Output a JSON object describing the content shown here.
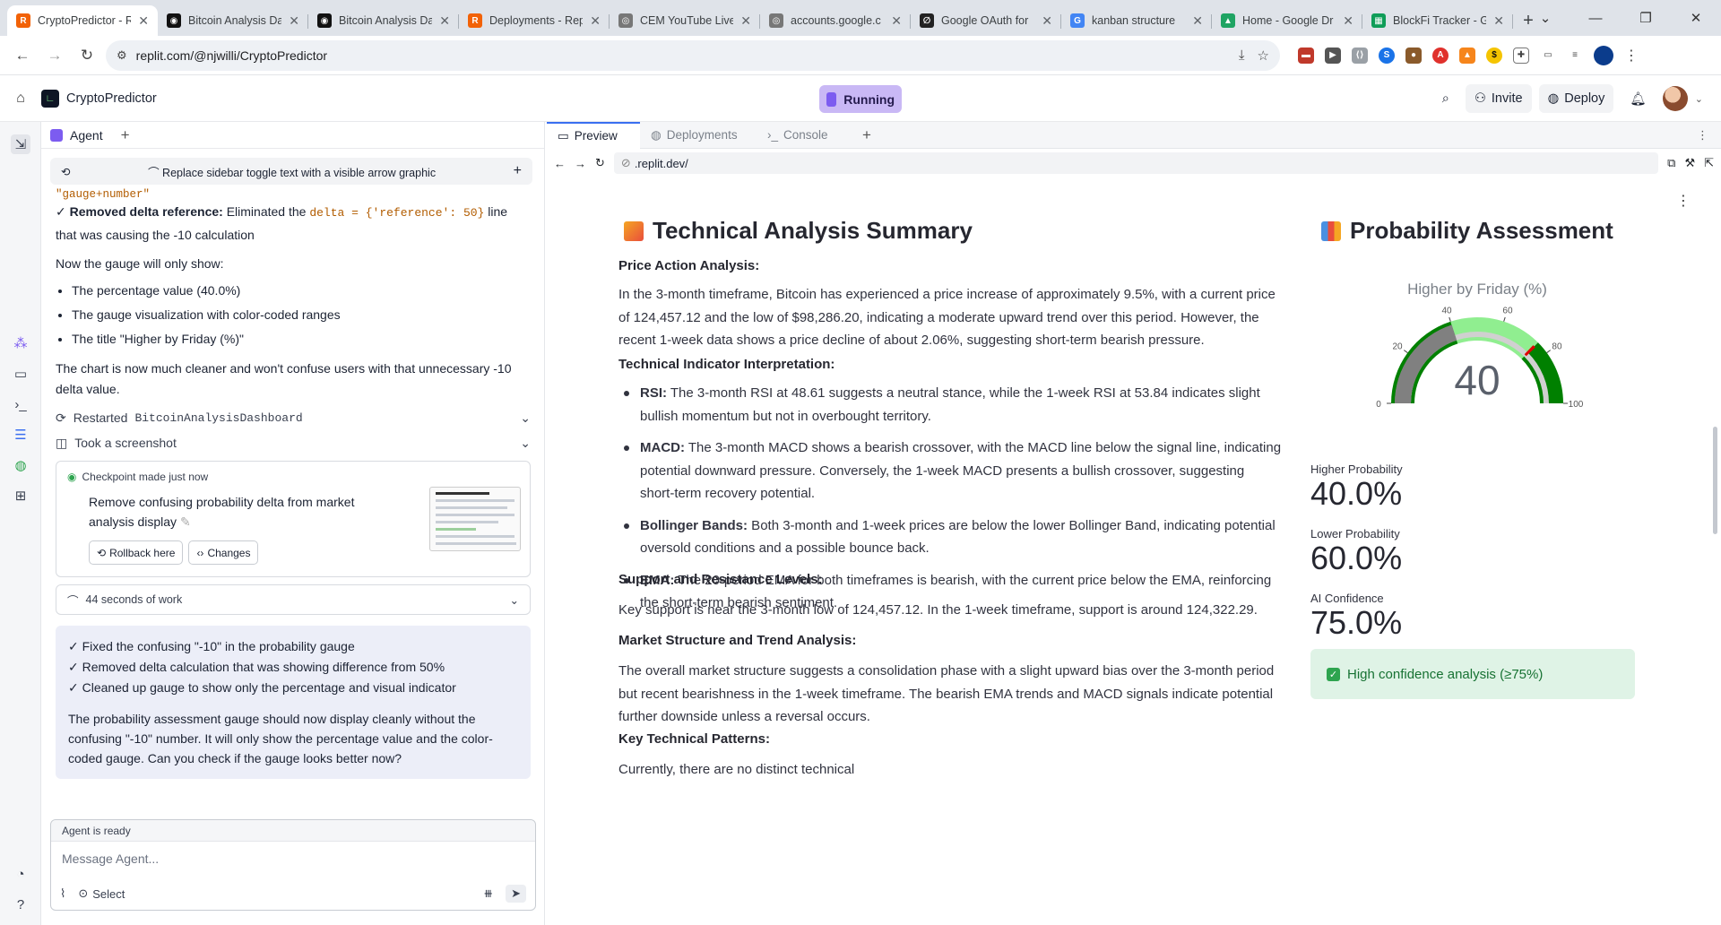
{
  "browser": {
    "tabs": [
      {
        "title": "CryptoPredictor - R",
        "color": "#f26207",
        "glyph": "R",
        "active": true
      },
      {
        "title": "Bitcoin Analysis Da",
        "color": "#111111",
        "glyph": "◉"
      },
      {
        "title": "Bitcoin Analysis Da",
        "color": "#111111",
        "glyph": "◉"
      },
      {
        "title": "Deployments - Rep",
        "color": "#f26207",
        "glyph": "R"
      },
      {
        "title": "CEM YouTube Live",
        "color": "#777777",
        "glyph": "◎"
      },
      {
        "title": "accounts.google.c",
        "color": "#777777",
        "glyph": "◎"
      },
      {
        "title": "Google OAuth for",
        "color": "#222222",
        "glyph": "∅"
      },
      {
        "title": "kanban structure",
        "color": "#4285f4",
        "glyph": "G"
      },
      {
        "title": "Home - Google Dr",
        "color": "#1fa463",
        "glyph": "▲"
      },
      {
        "title": "BlockFi Tracker - G",
        "color": "#0f9d58",
        "glyph": "▦"
      }
    ],
    "url": "replit.com/@njwilli/CryptoPredictor"
  },
  "header": {
    "repl_name": "CryptoPredictor",
    "run_status": "Running",
    "invite_label": "Invite",
    "deploy_label": "Deploy"
  },
  "agent": {
    "tab_label": "Agent",
    "history_title": "Replace sidebar toggle text with a visible arrow graphic",
    "fragment": "\"gauge+number\"",
    "removed_delta_bold": "Removed delta reference:",
    "removed_delta_pre": " Eliminated the ",
    "removed_delta_code": "delta = {'reference': 50}",
    "removed_delta_post": " line that was causing the -10 calculation",
    "gauge_intro": "Now the gauge will only show:",
    "gauge_points": [
      "The percentage value (40.0%)",
      "The gauge visualization with color-coded ranges",
      "The title \"Higher by Friday (%)\""
    ],
    "cleaner_note": "The chart is now much cleaner and won't confuse users with that unnecessary -10 delta value.",
    "restarted_label": "Restarted",
    "restarted_name": "BitcoinAnalysisDashboard",
    "screenshot_label": "Took a screenshot",
    "checkpoint_status": "Checkpoint made just now",
    "checkpoint_desc": "Remove confusing probability delta from market analysis display",
    "rollback_label": "Rollback here",
    "changes_label": "Changes",
    "work_time": "44 seconds of work",
    "summary_checks": [
      "✓ Fixed the confusing \"-10\" in the probability gauge",
      "✓ Removed delta calculation that was showing difference from 50%",
      "✓ Cleaned up gauge to show only the percentage and visual indicator"
    ],
    "summary_text": "The probability assessment gauge should now display cleanly without the confusing \"-10\" number. It will only show the percentage value and the color-coded gauge. Can you check if the gauge looks better now?",
    "input_status": "Agent is ready",
    "input_placeholder": "Message Agent...",
    "select_label": "Select"
  },
  "preview": {
    "tabs": [
      "Preview",
      "Deployments",
      "Console"
    ],
    "url": ".replit.dev/",
    "left": {
      "title": "Technical Analysis Summary",
      "price_action_h": "Price Action Analysis:",
      "price_action": "In the 3-month timeframe, Bitcoin has experienced a price increase of approximately 9.5%, with a current price of 124,457.12 and the low of $98,286.20, indicating a moderate upward trend over this period. However, the recent 1-week data shows a price decline of about 2.06%, suggesting short-term bearish pressure.",
      "indicator_h": "Technical Indicator Interpretation:",
      "indicators": [
        {
          "name": "RSI:",
          "text": " The 3-month RSI at 48.61 suggests a neutral stance, while the 1-week RSI at 53.84 indicates slight bullish momentum but not in overbought territory."
        },
        {
          "name": "MACD:",
          "text": " The 3-month MACD shows a bearish crossover, with the MACD line below the signal line, indicating potential downward pressure. Conversely, the 1-week MACD presents a bullish crossover, suggesting short-term recovery potential."
        },
        {
          "name": "Bollinger Bands:",
          "text": " Both 3-month and 1-week prices are below the lower Bollinger Band, indicating potential oversold conditions and a possible bounce back."
        },
        {
          "name": "EMA:",
          "text": " The 20-period EMA for both timeframes is bearish, with the current price below the EMA, reinforcing the short-term bearish sentiment."
        }
      ],
      "support_h": "Support and Resistance Levels:",
      "support": "Key support is near the 3-month low of 124,457.12. In the 1-week timeframe, support is around 124,322.29.",
      "structure_h": "Market Structure and Trend Analysis:",
      "structure": "The overall market structure suggests a consolidation phase with a slight upward bias over the 3-month period but recent bearishness in the 1-week timeframe. The bearish EMA trends and MACD signals indicate potential further downside unless a reversal occurs.",
      "patterns_h": "Key Technical Patterns:",
      "patterns": "Currently, there are no distinct technical"
    },
    "right": {
      "title": "Probability Assessment",
      "gauge": {
        "title": "Higher by Friday (%)",
        "value": 40,
        "value_label": "40",
        "min": 0,
        "max": 100,
        "ticks": [
          0,
          20,
          40,
          60,
          80,
          100
        ],
        "tick_labels": [
          "0",
          "20",
          "40",
          "60",
          "80",
          "100"
        ],
        "threshold": 75,
        "band_colors": {
          "low": "#008000",
          "mid": "#90ee90",
          "high": "#008000",
          "bar": "#808080",
          "track": "#d0d0d0",
          "threshold": "#e00000"
        }
      },
      "metrics": [
        {
          "label": "Higher Probability",
          "value": "40.0%"
        },
        {
          "label": "Lower Probability",
          "value": "60.0%"
        },
        {
          "label": "AI Confidence",
          "value": "75.0%"
        }
      ],
      "confidence_note": "High confidence analysis (≥75%)"
    }
  }
}
